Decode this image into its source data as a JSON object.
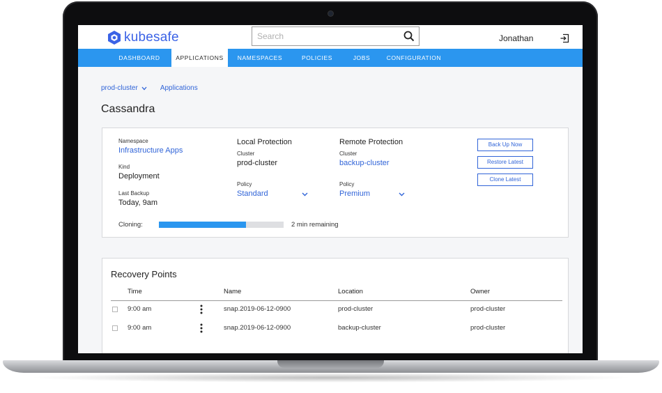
{
  "brand": {
    "name": "kubesafe",
    "color": "#3b63e6"
  },
  "search": {
    "placeholder": "Search",
    "icon": "search-icon"
  },
  "user": {
    "name": "Jonathan",
    "logout_icon": "logout-icon"
  },
  "nav": {
    "color": "#2b96ef",
    "items": [
      {
        "label": "DASHBOARD",
        "active": false
      },
      {
        "label": "APPLICATIONS",
        "active": true
      },
      {
        "label": "NAMESPACES",
        "active": false
      },
      {
        "label": "POLICIES",
        "active": false
      },
      {
        "label": "JOBS",
        "active": false
      },
      {
        "label": "CONFIGURATION",
        "active": false
      }
    ]
  },
  "breadcrumb": {
    "cluster": "prod-cluster",
    "section": "Applications"
  },
  "page": {
    "title": "Cassandra"
  },
  "details": {
    "namespace_label": "Namespace",
    "namespace_value": "Infrastructure Apps",
    "kind_label": "Kind",
    "kind_value": "Deployment",
    "last_backup_label": "Last Backup",
    "last_backup_value": "Today, 9am",
    "local": {
      "title": "Local Protection",
      "cluster_label": "Cluster",
      "cluster_value": "prod-cluster",
      "policy_label": "Policy",
      "policy_value": "Standard"
    },
    "remote": {
      "title": "Remote Protection",
      "cluster_label": "Cluster",
      "cluster_value": "backup-cluster",
      "policy_label": "Policy",
      "policy_value": "Premium"
    },
    "actions": {
      "back_up_now": "Back Up Now",
      "restore_latest": "Restore Latest",
      "clone_latest": "Clone Latest"
    },
    "progress": {
      "label": "Cloning:",
      "fraction": 0.7,
      "remaining": "2 min remaining"
    }
  },
  "recovery": {
    "title": "Recovery Points",
    "columns": {
      "time": "Time",
      "name": "Name",
      "location": "Location",
      "owner": "Owner"
    },
    "rows": [
      {
        "time": "9:00 am",
        "name": "snap.2019-06-12-0900",
        "location": "prod-cluster",
        "location_is_link": false,
        "owner": "prod-cluster"
      },
      {
        "time": "9:00 am",
        "name": "snap.2019-06-12-0900",
        "location": "backup-cluster",
        "location_is_link": true,
        "owner": "prod-cluster"
      }
    ]
  }
}
